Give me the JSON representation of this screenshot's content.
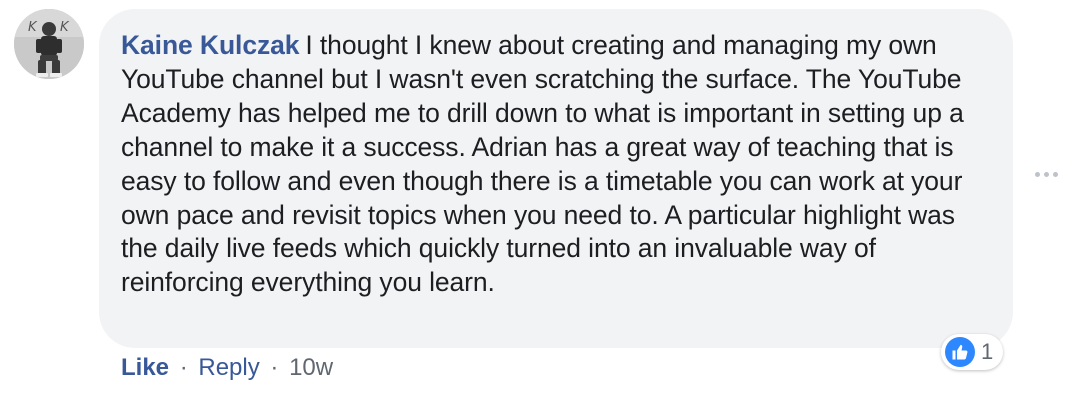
{
  "comment": {
    "author": "Kaine Kulczak",
    "text": "I thought I knew about creating and managing my own YouTube channel but I wasn't even scratching the surface. The YouTube Academy has helped me to drill down to what is important in setting up a channel to make it a success. Adrian has a great way of teaching that is easy to follow and even though there is a timetable you can work at your own pace and revisit topics when you need to. A particular highlight was the daily live feeds which quickly turned into an invaluable way of reinforcing everything you learn.",
    "avatar_icon": "user-avatar-icon"
  },
  "reaction": {
    "icon": "thumbs-up-icon",
    "count": "1",
    "color": "#2d88ff"
  },
  "actions": {
    "like_label": "Like",
    "separator": "·",
    "reply_label": "Reply",
    "timestamp": "10w"
  },
  "more_options_icon": "ellipsis-icon",
  "colors": {
    "author": "#385898",
    "bubble": "#f2f3f5",
    "text": "#1c1e21",
    "meta": "#606770"
  }
}
